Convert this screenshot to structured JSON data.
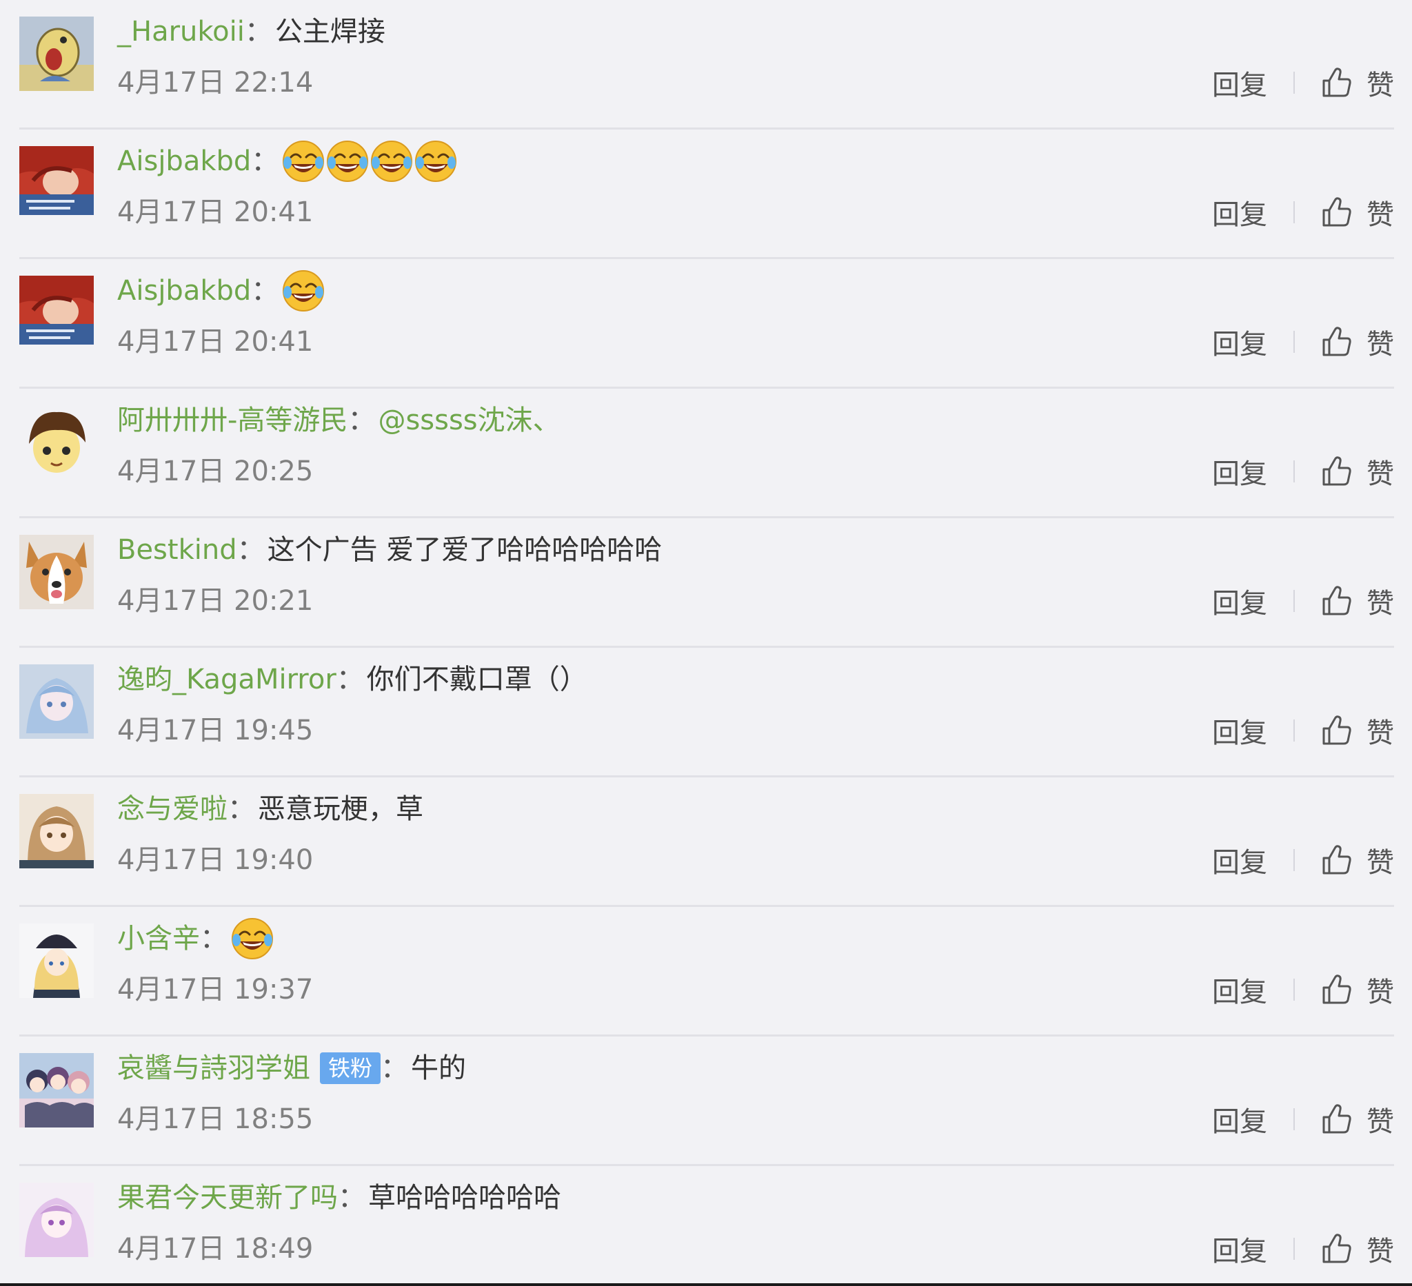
{
  "comments": [
    {
      "username": "_Harukoii",
      "colon": "：",
      "text": "公主焊接",
      "time": "4月17日 22:14",
      "reply_label": "回复",
      "like_label": "赞",
      "avatar_icon": "cartoon-bird-avatar-icon"
    },
    {
      "username": "Aisjbakbd",
      "colon": "：",
      "emoji_count": 4,
      "emoji_icon": "laughing-tears-emoji-icon",
      "time": "4月17日 20:41",
      "reply_label": "回复",
      "like_label": "赞",
      "avatar_icon": "red-hair-avatar-icon"
    },
    {
      "username": "Aisjbakbd",
      "colon": "：",
      "emoji_count": 1,
      "emoji_icon": "laughing-tears-emoji-icon",
      "time": "4月17日 20:41",
      "reply_label": "回复",
      "like_label": "赞",
      "avatar_icon": "red-hair-avatar-icon"
    },
    {
      "username": "阿卅卅卅-高等游民",
      "colon": "：",
      "mention": "@sssss沈沫、",
      "time": "4月17日 20:25",
      "reply_label": "回复",
      "like_label": "赞",
      "avatar_icon": "anime-boy-avatar-icon"
    },
    {
      "username": "Bestkind",
      "colon": "：",
      "text": "这个广告 爱了爱了哈哈哈哈哈哈",
      "time": "4月17日 20:21",
      "reply_label": "回复",
      "like_label": "赞",
      "avatar_icon": "corgi-dog-avatar-icon"
    },
    {
      "username": "逸昀_KagaMirror",
      "colon": "：",
      "text": "你们不戴口罩（）",
      "time": "4月17日 19:45",
      "reply_label": "回复",
      "like_label": "赞",
      "avatar_icon": "anime-girl-blue-avatar-icon"
    },
    {
      "username": "念与爱啦",
      "colon": "：",
      "text": "恶意玩梗，草",
      "time": "4月17日 19:40",
      "reply_label": "回复",
      "like_label": "赞",
      "avatar_icon": "anime-girl-brown-avatar-icon"
    },
    {
      "username": "小含辛",
      "colon": "：",
      "emoji_count": 1,
      "emoji_icon": "laughing-tears-emoji-icon",
      "time": "4月17日 19:37",
      "reply_label": "回复",
      "like_label": "赞",
      "avatar_icon": "anime-girl-hat-avatar-icon"
    },
    {
      "username": "哀醬与詩羽学姐",
      "colon": "：",
      "badge": "铁粉",
      "text": "牛的",
      "time": "4月17日 18:55",
      "reply_label": "回复",
      "like_label": "赞",
      "avatar_icon": "anime-group-avatar-icon"
    },
    {
      "username": "果君今天更新了吗",
      "colon": "：",
      "text": "草哈哈哈哈哈哈",
      "time": "4月17日 18:49",
      "reply_label": "回复",
      "like_label": "赞",
      "avatar_icon": "anime-girl-pink-avatar-icon"
    }
  ],
  "colors": {
    "background": "#f2f2f5",
    "username": "#6ea64a",
    "text": "#333333",
    "time": "#808080",
    "badge": "#68a8ee",
    "separator": "#e1e1e6"
  }
}
